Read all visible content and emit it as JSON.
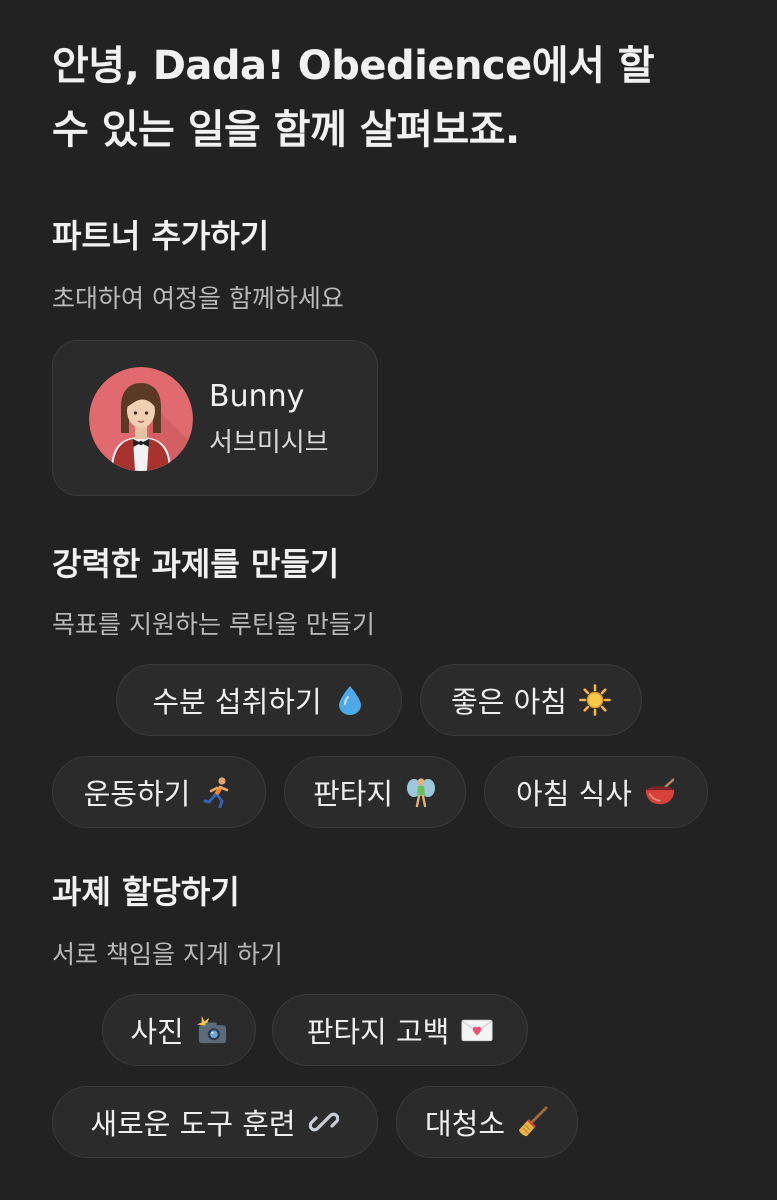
{
  "header": {
    "greeting_line1": "안녕, Dada! Obedience에서 할",
    "greeting_line2": "수 있는 일을 함께 살펴보죠."
  },
  "partner_section": {
    "title": "파트너 추가하기",
    "subtitle": "초대하여 여정을 함께하세요",
    "partner": {
      "name": "Bunny",
      "role": "서브미시브",
      "avatar_icon": "woman-waiter-avatar-icon"
    }
  },
  "tasks_section": {
    "title": "강력한 과제를 만들기",
    "subtitle": "목표를 지원하는 루틴을 만들기",
    "chips": [
      {
        "label": "수분 섭취하기",
        "icon": "water-drop-icon"
      },
      {
        "label": "좋은 아침",
        "icon": "sun-icon"
      },
      {
        "label": "운동하기",
        "icon": "running-person-icon"
      },
      {
        "label": "판타지",
        "icon": "fairy-icon"
      },
      {
        "label": "아침 식사",
        "icon": "bowl-icon"
      }
    ]
  },
  "assign_section": {
    "title": "과제 할당하기",
    "subtitle": "서로 책임을 지게 하기",
    "chips": [
      {
        "label": "사진",
        "icon": "camera-flash-icon"
      },
      {
        "label": "판타지 고백",
        "icon": "love-letter-icon"
      },
      {
        "label": "새로운 도구 훈련",
        "icon": "link-icon"
      },
      {
        "label": "대청소",
        "icon": "broom-icon"
      }
    ]
  },
  "colors": {
    "background": "#222222",
    "card": "#2b2b2b",
    "border": "#3a3a3a",
    "avatar_bg": "#e06a6e"
  }
}
